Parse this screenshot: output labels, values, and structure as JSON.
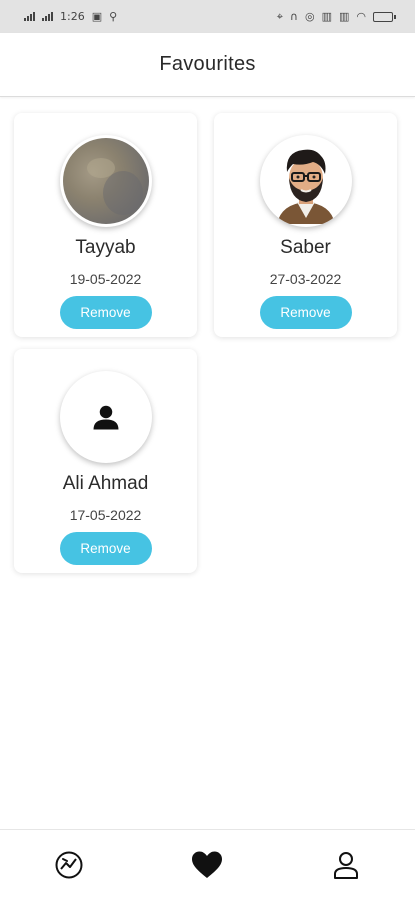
{
  "status_bar": {
    "time": "1:26"
  },
  "header": {
    "title": "Favourites"
  },
  "favourites": [
    {
      "name": "Tayyab",
      "date": "19-05-2022",
      "remove_label": "Remove",
      "avatar": "photo"
    },
    {
      "name": "Saber",
      "date": "27-03-2022",
      "remove_label": "Remove",
      "avatar": "cartoon-man-with-glasses"
    },
    {
      "name": "Ali Ahmad",
      "date": "17-05-2022",
      "remove_label": "Remove",
      "avatar": "default-person-icon"
    }
  ],
  "bottom_nav": {
    "items": [
      {
        "icon": "explore-icon",
        "active": false
      },
      {
        "icon": "heart-icon",
        "active": true
      },
      {
        "icon": "profile-icon",
        "active": false
      }
    ]
  },
  "colors": {
    "accent": "#46c3e3",
    "status_bar_bg": "#e3e3e3"
  }
}
